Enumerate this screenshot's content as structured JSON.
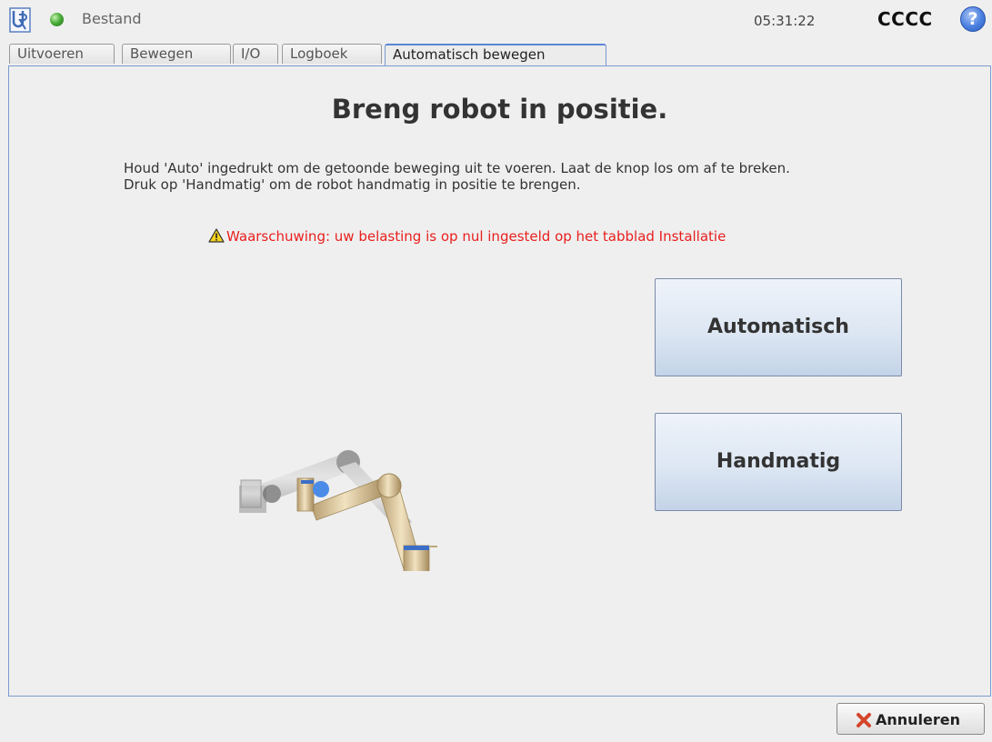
{
  "header": {
    "menu_label": "Bestand",
    "time": "05:31:22",
    "robot_name": "CCCC",
    "help_icon_text": "?"
  },
  "tabs": [
    {
      "label": "Uitvoeren",
      "active": false
    },
    {
      "label": "Bewegen",
      "active": false
    },
    {
      "label": "I/O",
      "active": false
    },
    {
      "label": "Logboek",
      "active": false
    },
    {
      "label": "Automatisch bewegen",
      "active": true
    }
  ],
  "main": {
    "title": "Breng robot in positie.",
    "instruction_line1": "Houd 'Auto' ingedrukt om de getoonde beweging uit te voeren. Laat de knop los om af te breken.",
    "instruction_line2": "Druk op 'Handmatig' om de robot handmatig in positie te brengen.",
    "warning": "Waarschuwing: uw belasting is op nul ingesteld op het tabblad Installatie",
    "auto_button": "Automatisch",
    "manual_button": "Handmatig"
  },
  "footer": {
    "cancel_button": "Annuleren"
  },
  "colors": {
    "warning_text": "#e8201e",
    "panel_border": "#7a9bd0",
    "status_ok": "#4caf3a"
  },
  "icons": [
    "ur-logo-icon",
    "status-ok-icon",
    "help-icon",
    "warning-icon",
    "close-icon"
  ]
}
